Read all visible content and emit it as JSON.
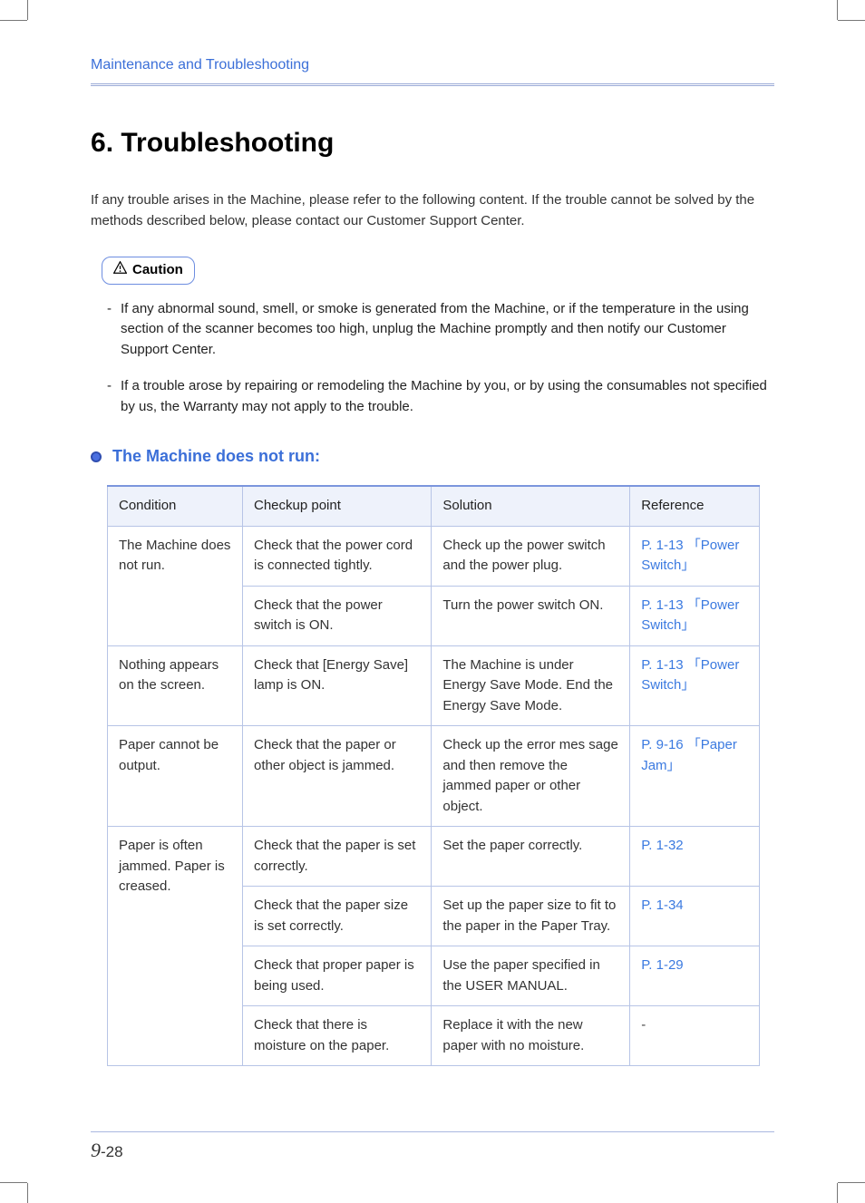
{
  "header": {
    "section_label": "Maintenance and Troubleshooting"
  },
  "chapter": {
    "number": "6",
    "title": "Troubleshooting"
  },
  "intro": "If any trouble arises in the Machine, please refer to the following content. If the trouble cannot be solved by the methods described below, please contact our Customer Support Center.",
  "caution": {
    "label": "Caution",
    "items": [
      "If any abnormal sound, smell, or smoke is generated from the Machine, or if the temperature in the using section of the scanner becomes too high, unplug the Machine promptly and then notify our Customer Support Center.",
      "If a trouble arose by repairing or remodeling the Machine by you, or by using the consumables not specified by us, the Warranty may not apply to the trouble."
    ]
  },
  "section": {
    "title": "The Machine does not run:"
  },
  "table": {
    "headers": {
      "condition": "Condition",
      "checkup": "Checkup point",
      "solution": "Solution",
      "reference": "Reference"
    },
    "rows": [
      {
        "group_start": true,
        "condition": "The Machine does not run.",
        "cond_rowspan": 2,
        "checkup": "Check that the power cord is connected tightly.",
        "solution": "Check up the power switch and the power plug.",
        "reference": "P. 1-13 「Power Switch」"
      },
      {
        "checkup": "Check that the power switch is ON.",
        "solution": "Turn the power switch ON.",
        "reference": "P. 1-13 「Power Switch」"
      },
      {
        "group_start": true,
        "condition": "Nothing appears on the screen.",
        "cond_rowspan": 1,
        "checkup": "Check that [Energy Save] lamp is ON.",
        "solution": "The Machine is under Energy Save Mode. End the Energy Save Mode.",
        "reference": "P. 1-13 「Power Switch」"
      },
      {
        "group_start": true,
        "condition": "Paper cannot be output.",
        "cond_rowspan": 1,
        "checkup": "Check that the paper or other object is jammed.",
        "solution": "Check up the error mes sage and then remove the jammed paper or other object.",
        "reference": "P. 9-16 「Paper Jam」"
      },
      {
        "group_start": true,
        "condition": "Paper is often jammed. Paper is creased.",
        "cond_rowspan": 4,
        "checkup": "Check that the paper is set correctly.",
        "solution": "Set the paper correctly.",
        "reference": "P. 1-32"
      },
      {
        "checkup": "Check that the paper size is set correctly.",
        "solution": "Set up the paper size to fit to the paper in the Paper Tray.",
        "reference": "P. 1-34"
      },
      {
        "checkup": "Check that proper paper is being used.",
        "solution": "Use the paper specified in the USER MANUAL.",
        "reference": "P. 1-29"
      },
      {
        "checkup": "Check that there is moisture on the paper.",
        "solution": "Replace it with the new paper with no moisture.",
        "reference": "-"
      }
    ]
  },
  "footer": {
    "page_major": "9",
    "page_minor": "-28"
  }
}
